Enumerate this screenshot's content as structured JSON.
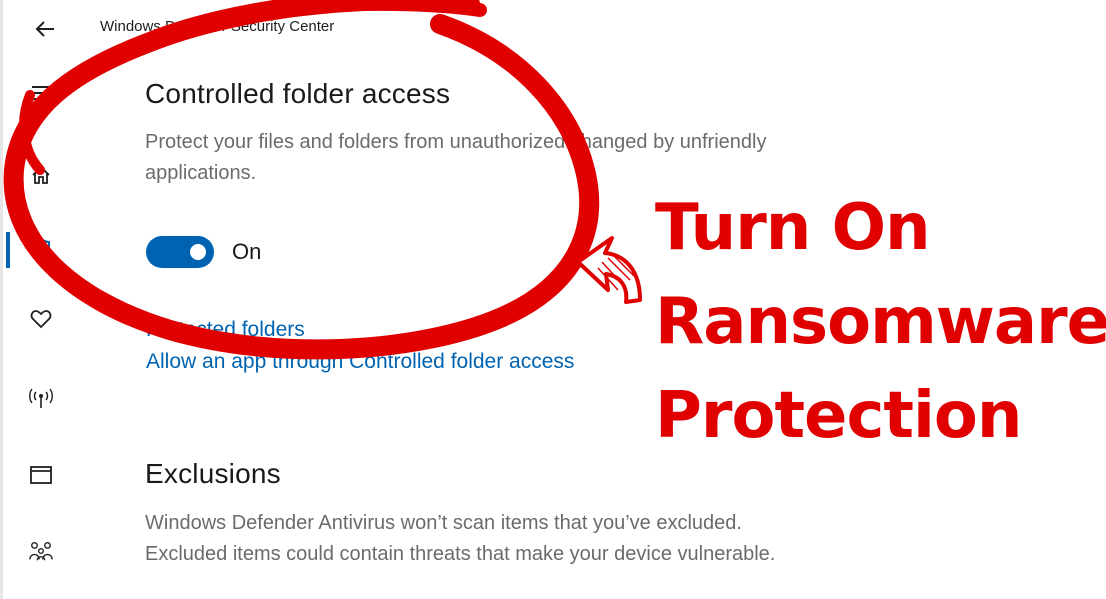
{
  "window": {
    "title": "Windows Defender Security Center"
  },
  "nav": {
    "items": [
      {
        "icon": "back-arrow-icon"
      },
      {
        "icon": "hamburger-menu-icon"
      },
      {
        "icon": "home-icon"
      },
      {
        "icon": "shield-icon"
      },
      {
        "icon": "heart-icon"
      },
      {
        "icon": "network-antenna-icon"
      },
      {
        "icon": "app-browser-icon"
      },
      {
        "icon": "family-icon"
      }
    ],
    "active_color": "#0063b1"
  },
  "cfa": {
    "heading": "Controlled folder access",
    "description_line1": "Protect your files and folders from unauthorized changed by unfriendly",
    "description_line2": "applications.",
    "toggle_state": "On",
    "toggle_on": true,
    "link_protected_folders": "Protected folders",
    "link_allow_app": "Allow an app through Controlled folder access"
  },
  "exclusions": {
    "heading": "Exclusions",
    "description_line1": "Windows Defender Antivirus won’t scan items that you’ve excluded.",
    "description_line2": "Excluded items could contain threats that make your device vulnerable."
  },
  "overlay": {
    "line1": "Turn On",
    "line2": "Ransomware",
    "line3": "Protection",
    "color": "#e00000"
  }
}
